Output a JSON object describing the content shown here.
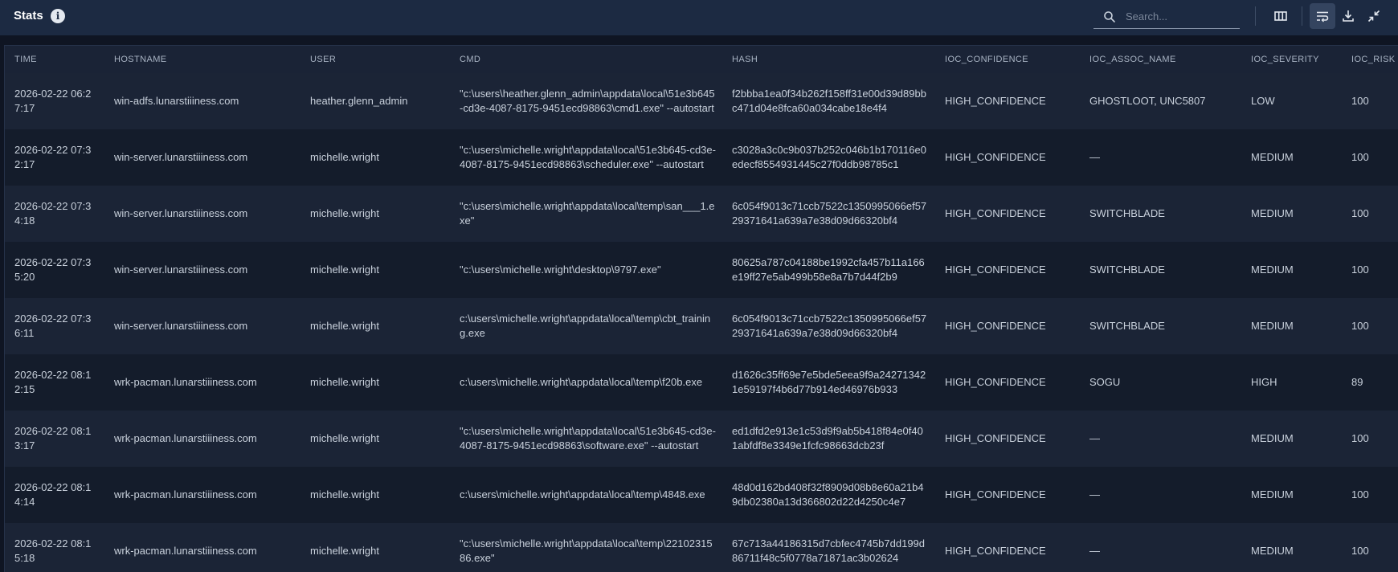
{
  "header": {
    "title": "Stats",
    "info_icon": "info-icon",
    "search_placeholder": "Search...",
    "search_value": "",
    "toolbar_icons": [
      "columns-icon",
      "wrap-text-icon",
      "download-icon",
      "collapse-icon"
    ]
  },
  "colors": {
    "header_bg": "#1c2a42",
    "table_bg": "#151d2e",
    "row_alt": "#1b2436",
    "text": "#c9d1dc"
  },
  "table": {
    "columns": [
      "TIME",
      "HOSTNAME",
      "USER",
      "CMD",
      "HASH",
      "IOC_CONFIDENCE",
      "IOC_ASSOC_NAME",
      "IOC_SEVERITY",
      "IOC_RISK"
    ],
    "rows": [
      {
        "time": "2026-02-22 06:27:17",
        "hostname": "win-adfs.lunarstiiiness.com",
        "user": "heather.glenn_admin",
        "cmd": "\"c:\\users\\heather.glenn_admin\\appdata\\local\\51e3b645-cd3e-4087-8175-9451ecd98863\\cmd1.exe\" --autostart",
        "hash": "f2bbba1ea0f34b262f158ff31e00d39d89bbc471d04e8fca60a034cabe18e4f4",
        "confidence": "HIGH_CONFIDENCE",
        "assoc": "GHOSTLOOT, UNC5807",
        "severity": "LOW",
        "risk": "100"
      },
      {
        "time": "2026-02-22 07:32:17",
        "hostname": "win-server.lunarstiiiness.com",
        "user": "michelle.wright",
        "cmd": "\"c:\\users\\michelle.wright\\appdata\\local\\51e3b645-cd3e-4087-8175-9451ecd98863\\scheduler.exe\" --autostart",
        "hash": "c3028a3c0c9b037b252c046b1b170116e0edecf8554931445c27f0ddb98785c1",
        "confidence": "HIGH_CONFIDENCE",
        "assoc": "—",
        "severity": "MEDIUM",
        "risk": "100"
      },
      {
        "time": "2026-02-22 07:34:18",
        "hostname": "win-server.lunarstiiiness.com",
        "user": "michelle.wright",
        "cmd": "\"c:\\users\\michelle.wright\\appdata\\local\\temp\\san___1.exe\"",
        "hash": "6c054f9013c71ccb7522c1350995066ef5729371641a639a7e38d09d66320bf4",
        "confidence": "HIGH_CONFIDENCE",
        "assoc": "SWITCHBLADE",
        "severity": "MEDIUM",
        "risk": "100"
      },
      {
        "time": "2026-02-22 07:35:20",
        "hostname": "win-server.lunarstiiiness.com",
        "user": "michelle.wright",
        "cmd": "\"c:\\users\\michelle.wright\\desktop\\9797.exe\"",
        "hash": "80625a787c04188be1992cfa457b11a166e19ff27e5ab499b58e8a7b7d44f2b9",
        "confidence": "HIGH_CONFIDENCE",
        "assoc": "SWITCHBLADE",
        "severity": "MEDIUM",
        "risk": "100"
      },
      {
        "time": "2026-02-22 07:36:11",
        "hostname": "win-server.lunarstiiiness.com",
        "user": "michelle.wright",
        "cmd": "c:\\users\\michelle.wright\\appdata\\local\\temp\\cbt_training.exe",
        "hash": "6c054f9013c71ccb7522c1350995066ef5729371641a639a7e38d09d66320bf4",
        "confidence": "HIGH_CONFIDENCE",
        "assoc": "SWITCHBLADE",
        "severity": "MEDIUM",
        "risk": "100"
      },
      {
        "time": "2026-02-22 08:12:15",
        "hostname": "wrk-pacman.lunarstiiiness.com",
        "user": "michelle.wright",
        "cmd": "c:\\users\\michelle.wright\\appdata\\local\\temp\\f20b.exe",
        "hash": "d1626c35ff69e7e5bde5eea9f9a242713421e59197f4b6d77b914ed46976b933",
        "confidence": "HIGH_CONFIDENCE",
        "assoc": "SOGU",
        "severity": "HIGH",
        "risk": "89"
      },
      {
        "time": "2026-02-22 08:13:17",
        "hostname": "wrk-pacman.lunarstiiiness.com",
        "user": "michelle.wright",
        "cmd": "\"c:\\users\\michelle.wright\\appdata\\local\\51e3b645-cd3e-4087-8175-9451ecd98863\\software.exe\" --autostart",
        "hash": "ed1dfd2e913e1c53d9f9ab5b418f84e0f401abfdf8e3349e1fcfc98663dcb23f",
        "confidence": "HIGH_CONFIDENCE",
        "assoc": "—",
        "severity": "MEDIUM",
        "risk": "100"
      },
      {
        "time": "2026-02-22 08:14:14",
        "hostname": "wrk-pacman.lunarstiiiness.com",
        "user": "michelle.wright",
        "cmd": "c:\\users\\michelle.wright\\appdata\\local\\temp\\4848.exe",
        "hash": "48d0d162bd408f32f8909d08b8e60a21b49db02380a13d366802d22d4250c4e7",
        "confidence": "HIGH_CONFIDENCE",
        "assoc": "—",
        "severity": "MEDIUM",
        "risk": "100"
      },
      {
        "time": "2026-02-22 08:15:18",
        "hostname": "wrk-pacman.lunarstiiiness.com",
        "user": "michelle.wright",
        "cmd": "\"c:\\users\\michelle.wright\\appdata\\local\\temp\\2210231586.exe\"",
        "hash": "67c713a44186315d7cbfec4745b7dd199d86711f48c5f0778a71871ac3b02624",
        "confidence": "HIGH_CONFIDENCE",
        "assoc": "—",
        "severity": "MEDIUM",
        "risk": "100"
      }
    ]
  }
}
